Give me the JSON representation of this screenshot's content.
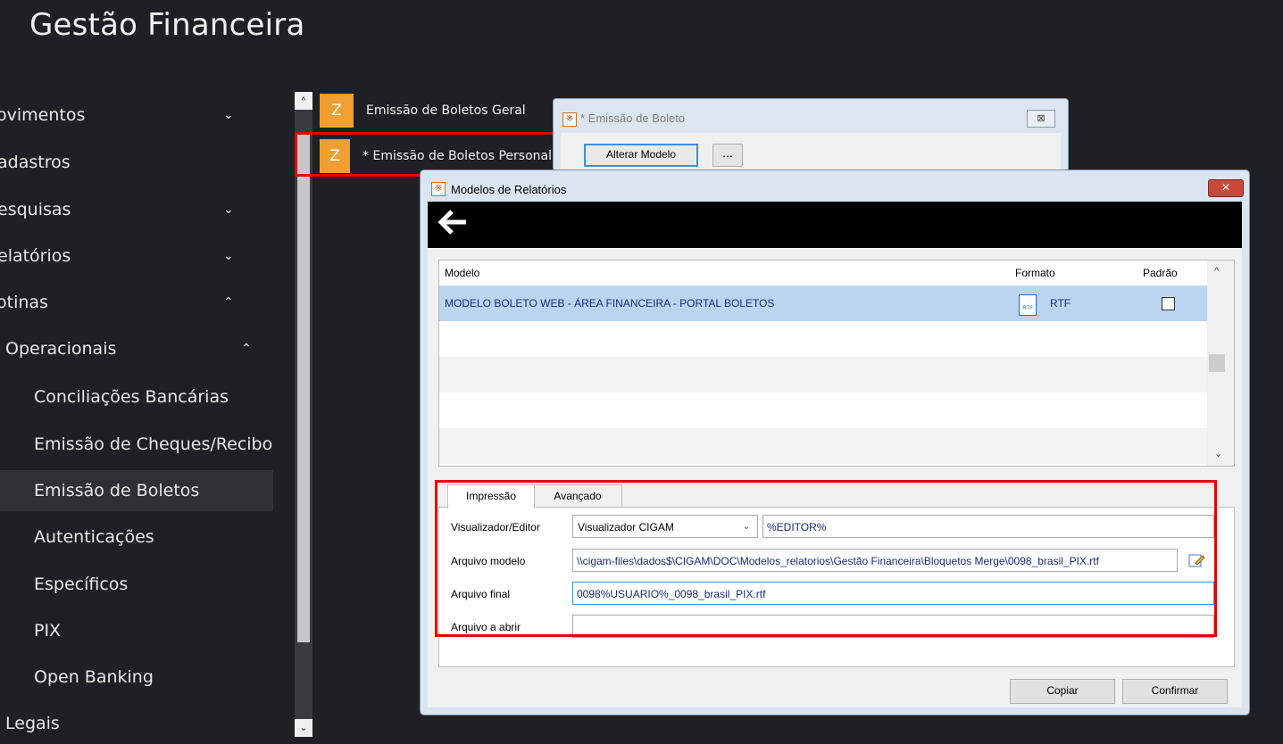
{
  "app": {
    "title": "Gestão Financeira"
  },
  "nav": {
    "items": [
      {
        "label": "ovimentos",
        "chevron": "⌄"
      },
      {
        "label": "adastros",
        "chevron": ""
      },
      {
        "label": "esquisas",
        "chevron": "⌄"
      },
      {
        "label": "elatórios",
        "chevron": "⌄"
      },
      {
        "label": "otinas",
        "chevron": "⌃"
      },
      {
        "label": "Operacionais",
        "chevron": "⌃"
      },
      {
        "label": "Conciliações Bancárias",
        "chevron": ""
      },
      {
        "label": "Emissão de Cheques/Recibo",
        "chevron": ""
      },
      {
        "label": "Emissão de Boletos",
        "chevron": ""
      },
      {
        "label": "Autenticações",
        "chevron": ""
      },
      {
        "label": "Específicos",
        "chevron": ""
      },
      {
        "label": "PIX",
        "chevron": ""
      },
      {
        "label": "Open Banking",
        "chevron": ""
      },
      {
        "label": "Legais",
        "chevron": ""
      }
    ],
    "active_label": "Emissão de Boletos"
  },
  "scroll": {
    "up": "^",
    "down": "⌄"
  },
  "tiles": [
    {
      "icon": "Z",
      "label": "Emissão de Boletos Geral"
    },
    {
      "icon": "Z",
      "label": "* Emissão de Boletos Personal"
    }
  ],
  "win_back": {
    "title": "* Emissão de Boleto",
    "close": "⊠",
    "alterar_label": "Alterar Modelo",
    "dots_label": "..."
  },
  "dialog": {
    "title": "Modelos de Relatórios",
    "close": "✕",
    "back_arrow": "🡐",
    "grid": {
      "headers": {
        "modelo": "Modelo",
        "formato": "Formato",
        "padrao": "Padrão"
      },
      "rows": [
        {
          "modelo": "MODELO BOLETO WEB - ÁREA FINANCEIRA - PORTAL BOLETOS",
          "formato": "RTF",
          "padrao": false
        }
      ],
      "rtf_icon_text": "RTF",
      "scroll_up": "^",
      "scroll_down": "⌄"
    },
    "tabs": [
      {
        "label": "Impressão"
      },
      {
        "label": "Avançado"
      }
    ],
    "form": {
      "visualizador_label": "Visualizador/Editor",
      "visualizador_value": "Visualizador CIGAM",
      "visualizador_arrow": "⌄",
      "editor_value": "%EDITOR%",
      "arquivo_modelo_label": "Arquivo modelo",
      "arquivo_modelo_value": "\\\\cigam-files\\dados$\\CIGAM\\DOC\\Modelos_relatorios\\Gestão Financeira\\Bloquetos Merge\\0098_brasil_PIX.rtf",
      "arquivo_final_label": "Arquivo final",
      "arquivo_final_value": "0098%USUARIO%_0098_brasil_PIX.rtf",
      "arquivo_abrir_label": "Arquivo a abrir",
      "arquivo_abrir_value": ""
    },
    "buttons": {
      "copiar": "Copiar",
      "confirmar": "Confirmar"
    }
  },
  "colors": {
    "highlight_red": "#e60000",
    "tile_orange": "#f0a030",
    "selection_blue": "#bbd5f0",
    "sidebar_bg": "#1f2025"
  }
}
